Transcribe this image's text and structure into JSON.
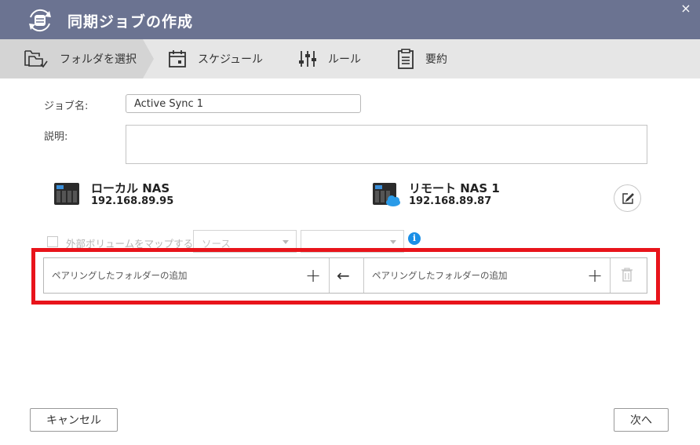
{
  "window": {
    "title": "同期ジョブの作成",
    "close_glyph": "×"
  },
  "steps": [
    {
      "label": "フォルダを選択",
      "icon": "folder-select-icon",
      "active": true
    },
    {
      "label": "スケジュール",
      "icon": "calendar-icon",
      "active": false
    },
    {
      "label": "ルール",
      "icon": "sliders-icon",
      "active": false
    },
    {
      "label": "要約",
      "icon": "clipboard-icon",
      "active": false
    }
  ],
  "form": {
    "job_name_label": "ジョブ名:",
    "job_name_value": "Active Sync 1",
    "description_label": "説明:",
    "description_value": ""
  },
  "local_nas": {
    "name": "ローカル NAS",
    "ip": "192.168.89.95"
  },
  "remote_nas": {
    "name": "リモート NAS 1",
    "ip": "192.168.89.87"
  },
  "map_volume": {
    "checkbox_label": "外部ボリュームをマップする",
    "source_select": "ソース",
    "target_select": ""
  },
  "pairing": {
    "left_placeholder": "ペアリングしたフォルダーの追加",
    "right_placeholder": "ペアリングしたフォルダーの追加",
    "add_glyph": "+",
    "direction_glyph": "←"
  },
  "footer": {
    "cancel_label": "キャンセル",
    "next_label": "次へ"
  },
  "colors": {
    "titlebar": "#6b7391",
    "stepbar": "#e6e6e6",
    "highlight": "#e8141b",
    "info": "#1a8fe6"
  }
}
